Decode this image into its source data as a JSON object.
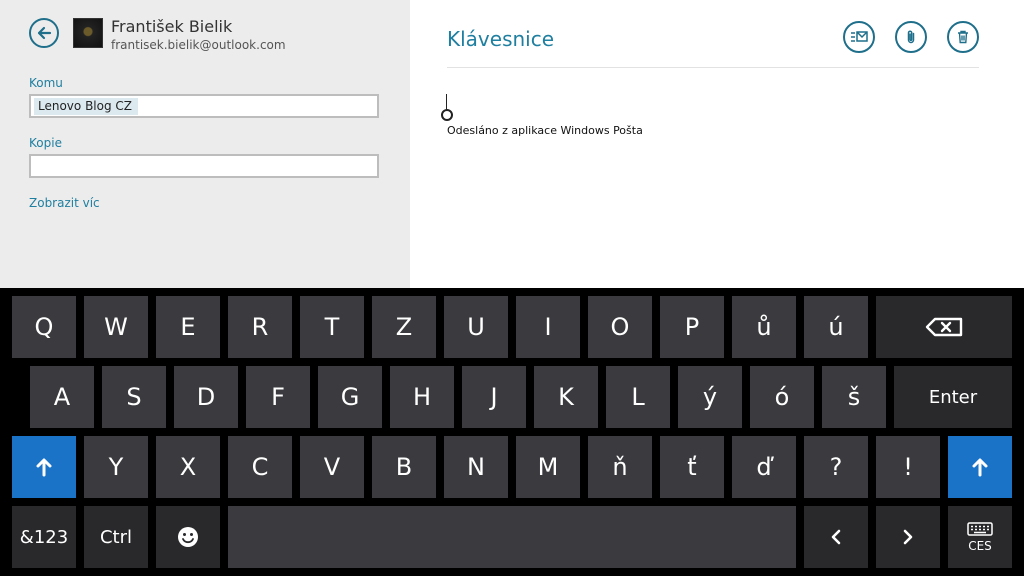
{
  "sender": {
    "name": "František Bielik",
    "email": "frantisek.bielik@outlook.com"
  },
  "to": {
    "label": "Komu",
    "recipient": "Lenovo Blog CZ"
  },
  "cc": {
    "label": "Kopie",
    "value": ""
  },
  "show_more": "Zobrazit víc",
  "message": {
    "subject": "Klávesnice",
    "signature": "Odesláno z aplikace Windows Pošta"
  },
  "toolbar": {
    "send_icon": "send-mail-icon",
    "attach_icon": "paperclip-icon",
    "delete_icon": "trash-icon"
  },
  "keyboard": {
    "row1": [
      "Q",
      "W",
      "E",
      "R",
      "T",
      "Z",
      "U",
      "I",
      "O",
      "P",
      "ů",
      "ú"
    ],
    "row2": [
      "A",
      "S",
      "D",
      "F",
      "G",
      "H",
      "J",
      "K",
      "L",
      "ý",
      "ó",
      "š"
    ],
    "enter": "Enter",
    "row3": [
      "Y",
      "X",
      "C",
      "V",
      "B",
      "N",
      "M",
      "ň",
      "ť",
      "ď",
      "?",
      "!"
    ],
    "symbols": "&123",
    "ctrl": "Ctrl",
    "language": "CES"
  },
  "colors": {
    "accent": "#1f7fa0",
    "shift_key": "#1a73c7",
    "key": "#3b3b3f",
    "key_dark": "#29292c"
  }
}
